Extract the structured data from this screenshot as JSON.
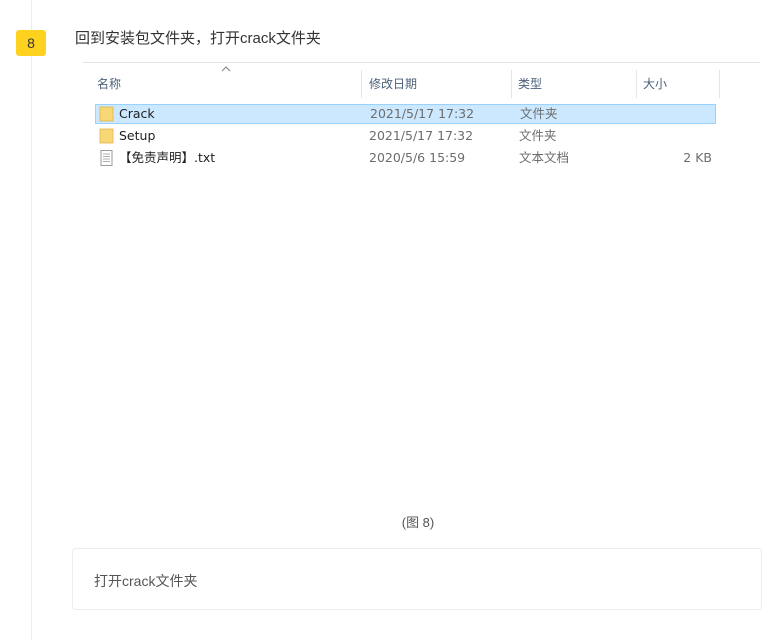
{
  "step": {
    "number": "8",
    "title": "回到安装包文件夹，打开crack文件夹"
  },
  "explorer": {
    "columns": {
      "name": "名称",
      "date": "修改日期",
      "type": "类型",
      "size": "大小"
    },
    "files": [
      {
        "name": "Crack",
        "date": "2021/5/17 17:32",
        "type": "文件夹",
        "size": "",
        "icon": "folder-icon",
        "selected": true
      },
      {
        "name": "Setup",
        "date": "2021/5/17 17:32",
        "type": "文件夹",
        "size": "",
        "icon": "folder-icon",
        "selected": false
      },
      {
        "name": "【免责声明】.txt",
        "date": "2020/5/6 15:59",
        "type": "文本文档",
        "size": "2 KB",
        "icon": "text-file-icon",
        "selected": false
      }
    ]
  },
  "caption": "(图 8)",
  "note": "打开crack文件夹",
  "colors": {
    "badge": "#ffd21f",
    "selection_fill": "#cce8ff",
    "selection_border": "#99d1ff",
    "folder": "#f8d775"
  }
}
